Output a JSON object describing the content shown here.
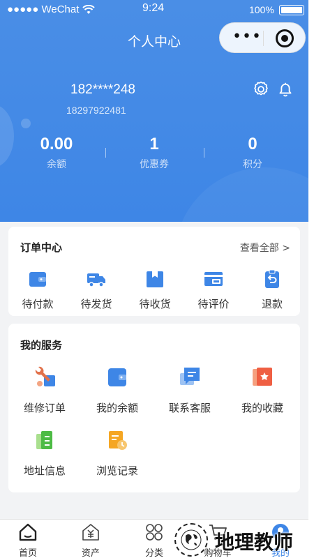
{
  "status_bar": {
    "carrier": "●●●●● WeChat",
    "time": "9:24",
    "battery": "100%"
  },
  "nav": {
    "title": "个人中心",
    "capsule_more": "•••"
  },
  "profile": {
    "name": "182****248",
    "phone": "18297922481"
  },
  "stats": [
    {
      "value": "0.00",
      "label": "余额"
    },
    {
      "value": "1",
      "label": "优惠券"
    },
    {
      "value": "0",
      "label": "积分"
    }
  ],
  "orders": {
    "title": "订单中心",
    "view_all": "查看全部 >",
    "items": [
      {
        "label": "待付款",
        "icon": "wallet-icon"
      },
      {
        "label": "待发货",
        "icon": "truck-icon"
      },
      {
        "label": "待收货",
        "icon": "box-icon"
      },
      {
        "label": "待评价",
        "icon": "card-icon"
      },
      {
        "label": "退款",
        "icon": "return-icon"
      }
    ]
  },
  "services": {
    "title": "我的服务",
    "items": [
      {
        "label": "维修订单",
        "icon": "wrench-icon"
      },
      {
        "label": "我的余额",
        "icon": "balance-icon"
      },
      {
        "label": "联系客服",
        "icon": "chat-icon"
      },
      {
        "label": "我的收藏",
        "icon": "favorite-icon"
      },
      {
        "label": "地址信息",
        "icon": "address-icon"
      },
      {
        "label": "浏览记录",
        "icon": "history-icon"
      }
    ]
  },
  "tabs": [
    {
      "label": "首页",
      "icon": "home-icon"
    },
    {
      "label": "资产",
      "icon": "assets-icon"
    },
    {
      "label": "分类",
      "icon": "category-icon"
    },
    {
      "label": "购物车",
      "icon": "cart-icon"
    },
    {
      "label": "我的",
      "icon": "user-icon"
    }
  ],
  "watermark": {
    "text": "地理教师"
  },
  "colors": {
    "primary": "#3e86e6",
    "background": "#f2f3f5"
  }
}
